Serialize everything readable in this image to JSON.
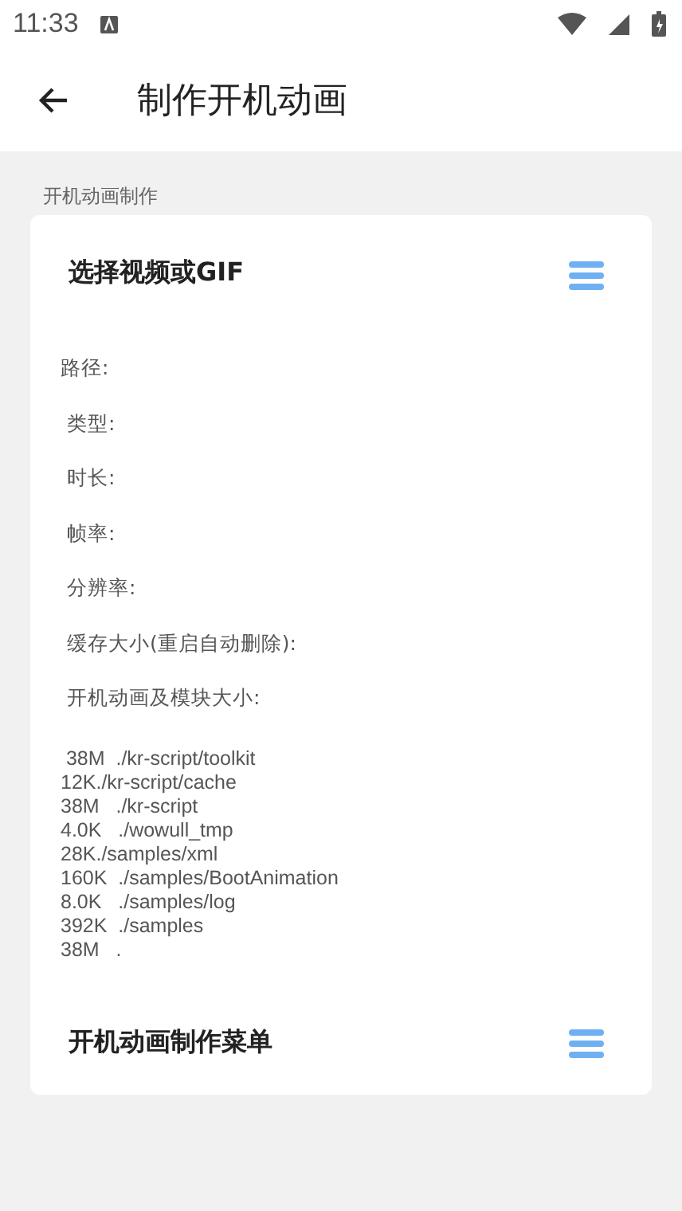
{
  "status_bar": {
    "time": "11:33"
  },
  "app_bar": {
    "title": "制作开机动画"
  },
  "section_label": "开机动画制作",
  "card": {
    "title": "选择视频或GIF",
    "info_lines": [
      "路径:",
      " 类型:",
      " 时长:",
      " 帧率:",
      " 分辨率:",
      " 缓存大小(重启自动删除):",
      " 开机动画及模块大小:"
    ],
    "size_lines": [
      " 38M  ./kr-script/toolkit",
      "12K./kr-script/cache",
      "38M   ./kr-script",
      "4.0K   ./wowull_tmp",
      "28K./samples/xml",
      "160K  ./samples/BootAnimation",
      "8.0K   ./samples/log",
      "392K  ./samples",
      "38M   ."
    ],
    "menu_title": "开机动画制作菜单"
  }
}
